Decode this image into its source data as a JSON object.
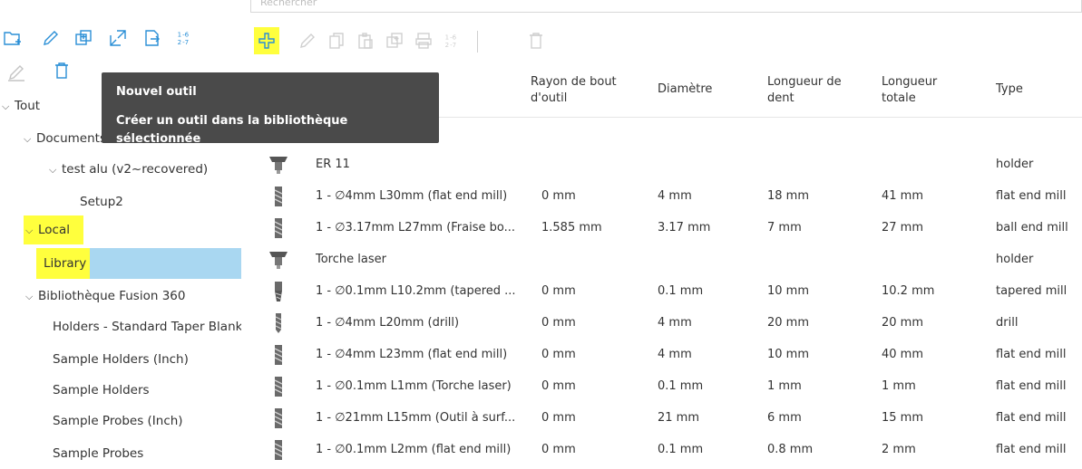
{
  "search": {
    "placeholder": "Rechercher"
  },
  "tooltip": {
    "title": "Nouvel outil",
    "description": "Créer un outil dans la bibliothèque sélectionnée"
  },
  "sidebar": {
    "toolbar": {
      "renumber_label": "1-6 2-7"
    },
    "tree": [
      {
        "label": "Tout",
        "level": 0,
        "expanded": true
      },
      {
        "label": "Documents",
        "level": 1,
        "expanded": true
      },
      {
        "label": "test alu (v2~recovered)",
        "level": 2,
        "expanded": true
      },
      {
        "label": "Setup2",
        "level": 3
      },
      {
        "label": "Local",
        "level": 0,
        "expanded": true,
        "highlight": true
      },
      {
        "label": "Library",
        "level": 1,
        "selected": true,
        "highlight": true
      },
      {
        "label": "Bibliothèque Fusion 360",
        "level": 0,
        "expanded": true
      },
      {
        "label": "Holders - Standard Taper Blank",
        "level": 1
      },
      {
        "label": "Sample Holders (Inch)",
        "level": 1
      },
      {
        "label": "Sample Holders",
        "level": 1
      },
      {
        "label": "Sample Probes (Inch)",
        "level": 1
      },
      {
        "label": "Sample Probes",
        "level": 1
      }
    ]
  },
  "toolbar": {
    "renumber_label": "1-6 2-7"
  },
  "table": {
    "columns": [
      {
        "key": "tip_radius",
        "label": "Rayon de bout d'outil"
      },
      {
        "key": "diameter",
        "label": "Diamètre"
      },
      {
        "key": "flute_length",
        "label": "Longueur de dent"
      },
      {
        "key": "total_length",
        "label": "Longueur totale"
      },
      {
        "key": "type",
        "label": "Type"
      }
    ],
    "rows": [
      {
        "kind": "holder",
        "icon": "holder-icon",
        "name": "ER 11",
        "tip_radius": "",
        "diameter": "",
        "flute_length": "",
        "total_length": "",
        "type": "holder"
      },
      {
        "kind": "tool",
        "icon": "end-mill-icon",
        "name": "1 - ∅4mm L30mm (flat end mill)",
        "tip_radius": "0 mm",
        "diameter": "4 mm",
        "flute_length": "18 mm",
        "total_length": "41 mm",
        "type": "flat end mill"
      },
      {
        "kind": "tool",
        "icon": "end-mill-icon",
        "name": "1 - ∅3.17mm L27mm (Fraise bo...",
        "tip_radius": "1.585 mm",
        "diameter": "3.17 mm",
        "flute_length": "7 mm",
        "total_length": "27 mm",
        "type": "ball end mill"
      },
      {
        "kind": "holder",
        "icon": "holder-icon",
        "name": "Torche laser",
        "tip_radius": "",
        "diameter": "",
        "flute_length": "",
        "total_length": "",
        "type": "holder"
      },
      {
        "kind": "tool",
        "icon": "tapered-mill-icon",
        "name": "1 - ∅0.1mm L10.2mm (tapered ...",
        "tip_radius": "0 mm",
        "diameter": "0.1 mm",
        "flute_length": "10 mm",
        "total_length": "10.2 mm",
        "type": "tapered mill"
      },
      {
        "kind": "tool",
        "icon": "drill-icon",
        "name": "1 - ∅4mm L20mm (drill)",
        "tip_radius": "0 mm",
        "diameter": "4 mm",
        "flute_length": "20 mm",
        "total_length": "20 mm",
        "type": "drill"
      },
      {
        "kind": "tool",
        "icon": "end-mill-icon",
        "name": "1 - ∅4mm L23mm (flat end mill)",
        "tip_radius": "0 mm",
        "diameter": "4 mm",
        "flute_length": "10 mm",
        "total_length": "40 mm",
        "type": "flat end mill"
      },
      {
        "kind": "tool",
        "icon": "end-mill-icon",
        "name": "1 - ∅0.1mm L1mm (Torche laser)",
        "tip_radius": "0 mm",
        "diameter": "0.1 mm",
        "flute_length": "1 mm",
        "total_length": "1 mm",
        "type": "flat end mill"
      },
      {
        "kind": "tool",
        "icon": "end-mill-icon",
        "name": "1 - ∅21mm L15mm (Outil à surf...",
        "tip_radius": "0 mm",
        "diameter": "21 mm",
        "flute_length": "6 mm",
        "total_length": "15 mm",
        "type": "flat end mill"
      },
      {
        "kind": "tool",
        "icon": "end-mill-icon",
        "name": "1 - ∅0.1mm L2mm (flat end mill)",
        "tip_radius": "0 mm",
        "diameter": "0.1 mm",
        "flute_length": "0.8 mm",
        "total_length": "2 mm",
        "type": "flat end mill"
      }
    ]
  },
  "colors": {
    "accent": "#2a8fd6",
    "highlight": "#ffff3d",
    "selection": "#a9d7f1",
    "tooltip_bg": "#4a4a4a"
  }
}
